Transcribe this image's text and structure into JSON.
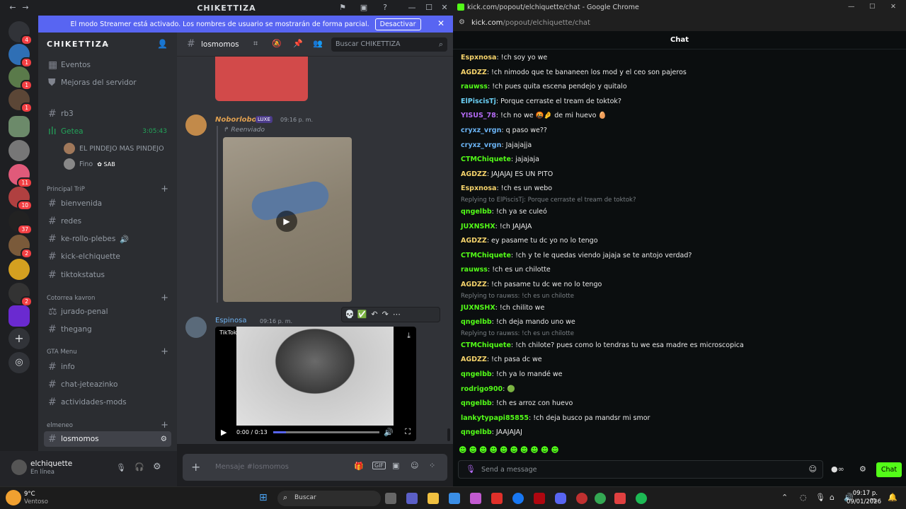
{
  "discord": {
    "title": "CHIKETTIZA",
    "banner": {
      "text": "El modo Streamer está activado. Los nombres de usuario se mostrarán de forma parcial.",
      "button": "Desactivar"
    },
    "server_name": "CHIKETTIZA",
    "guild_badges": [
      "4",
      "1",
      "1",
      "1",
      "",
      "",
      "11",
      "10",
      "37",
      "2",
      "",
      "",
      "2"
    ],
    "sidebar": {
      "top_items": [
        {
          "label": "Eventos"
        },
        {
          "label": "Mejoras del servidor"
        }
      ],
      "channels": [
        {
          "label": "rb3"
        },
        {
          "label": "Getea",
          "time": "3:05:43"
        },
        {
          "label": "bienvenida"
        },
        {
          "label": "redes"
        },
        {
          "label": "ke-rollo-plebes"
        },
        {
          "label": "kick-elchiquette"
        },
        {
          "label": "tiktokstatus"
        },
        {
          "label": "jurado-penal"
        },
        {
          "label": "thegang"
        },
        {
          "label": "info"
        },
        {
          "label": "chat-jeteazinko"
        },
        {
          "label": "actividades-mods"
        },
        {
          "label": "losmomos"
        }
      ],
      "voice_users": [
        {
          "name": "EL PINDEJO MAS PINDEJO"
        },
        {
          "name": "Fino",
          "badge": "SAB"
        }
      ],
      "categories": [
        "Principal TriP",
        "Cotorrea kavron",
        "GTA Menu",
        "elmeneo"
      ]
    },
    "channel_header": {
      "name": "losmomos",
      "search_placeholder": "Buscar CHIKETTIZA"
    },
    "messages": [
      {
        "author": "Noborlobo",
        "tag": "LUXE",
        "time": "09:16 p. m.",
        "forwarded": "Reenviado"
      },
      {
        "author": "Espinosa",
        "time": "09:16 p. m.",
        "tiktok": "TikTok",
        "video_time": "0:00 / 0:13"
      }
    ],
    "input_placeholder": "Mensaje #losmomos",
    "user": {
      "name": "elchiquette",
      "status": "En línea"
    }
  },
  "kick": {
    "window_title": "kick.com/popout/elchiquette/chat - Google Chrome",
    "url_host": "kick.com",
    "url_path": "/popout/elchiquette/chat",
    "header": "Chat",
    "messages": [
      {
        "user": "Espxnosa",
        "color": "#f5d36b",
        "text": "!ch soy yo we"
      },
      {
        "user": "AGDZZ",
        "color": "#f5d36b",
        "text": "!ch nimodo que te bananeen los mod y el ceo son pajeros"
      },
      {
        "user": "rauwss",
        "color": "#53fc18",
        "text": "!ch pues quita escena pendejo y quitalo"
      },
      {
        "user": "ElPiscisTj",
        "color": "#6bd0f5",
        "text": "Porque cerraste el tream de toktok?"
      },
      {
        "user": "YISUS_78",
        "color": "#b46bf5",
        "text": "!ch no we 🤬🤌 de mi huevo 🥚"
      },
      {
        "user": "cryxz_vrgn",
        "color": "#6bb4f5",
        "text": "q paso we??"
      },
      {
        "user": "cryxz_vrgn",
        "color": "#6bb4f5",
        "text": "Jajajajja"
      },
      {
        "user": "CTMChiquete",
        "color": "#53fc18",
        "text": "jajajaja"
      },
      {
        "user": "AGDZZ",
        "color": "#f5d36b",
        "text": "JAJAJAJ ES UN PITO"
      },
      {
        "user": "Espxnosa",
        "color": "#f5d36b",
        "text": "!ch es un webo"
      },
      {
        "reply": "Replying to ElPiscisTj: Porque cerraste el tream de toktok?"
      },
      {
        "user": "qngelbb",
        "color": "#53fc18",
        "text": "!ch ya se culeó"
      },
      {
        "user": "JUXNSHX",
        "color": "#53fc18",
        "text": "!ch JAJAJA"
      },
      {
        "user": "AGDZZ",
        "color": "#f5d36b",
        "text": "ey pasame tu dc yo no lo tengo"
      },
      {
        "user": "CTMChiquete",
        "color": "#53fc18",
        "text": "!ch y te le quedas viendo jajaja se te antojo verdad?"
      },
      {
        "user": "rauwss",
        "color": "#53fc18",
        "text": "!ch es un chilotte"
      },
      {
        "user": "AGDZZ",
        "color": "#f5d36b",
        "text": "!ch pasame tu dc we no lo tengo"
      },
      {
        "reply": "Replying to rauwss: !ch es un chilotte"
      },
      {
        "user": "JUXNSHX",
        "color": "#53fc18",
        "text": "!ch chilito we"
      },
      {
        "user": "qngelbb",
        "color": "#53fc18",
        "text": "!ch deja mando uno we"
      },
      {
        "reply": "Replying to rauwss: !ch es un chilotte"
      },
      {
        "user": "CTMChiquete",
        "color": "#53fc18",
        "text": "!ch chilote? pues como lo tendras tu we esa madre es microscopica"
      },
      {
        "user": "AGDZZ",
        "color": "#f5d36b",
        "text": "!ch pasa dc we"
      },
      {
        "user": "qngelbb",
        "color": "#53fc18",
        "text": "!ch ya lo mandé we"
      },
      {
        "user": "rodrigo900",
        "color": "#53fc18",
        "text": "🟢"
      },
      {
        "user": "qngelbb",
        "color": "#53fc18",
        "text": "!ch es arroz con huevo"
      },
      {
        "user": "lankytypapi85855",
        "color": "#53fc18",
        "text": "!ch deja busco pa mandsr mi smor"
      },
      {
        "user": "qngelbb",
        "color": "#53fc18",
        "text": "JAAJAJAJ"
      }
    ],
    "input_placeholder": "Send a message",
    "send_label": "Chat"
  },
  "taskbar": {
    "weather_temp": "9°C",
    "weather_desc": "Ventoso",
    "search_label": "Buscar",
    "time": "09:17 p. m.",
    "date": "09/01/2026"
  },
  "colors": {
    "discord_blurple": "#5865f2",
    "kick_green": "#53fc18"
  }
}
